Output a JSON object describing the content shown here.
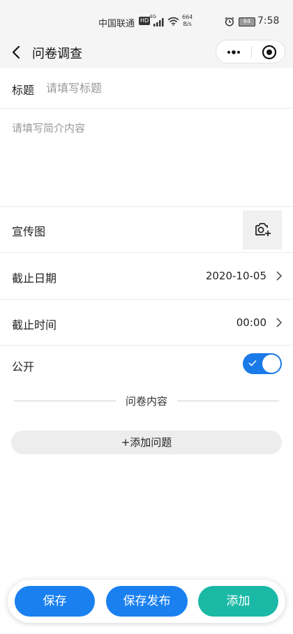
{
  "status_bar": {
    "carrier": "中国联通",
    "hd": "HD",
    "network": "4G",
    "speed_value": "664",
    "speed_unit": "B/s",
    "battery": "64",
    "time": "7:58"
  },
  "navbar": {
    "title": "问卷调查"
  },
  "form": {
    "title_label": "标题",
    "title_placeholder": "请填写标题",
    "intro_placeholder": "请填写简介内容",
    "banner_label": "宣传图",
    "deadline_date_label": "截止日期",
    "deadline_date_value": "2020-10-05",
    "deadline_time_label": "截止时间",
    "deadline_time_value": "00:00",
    "public_label": "公开",
    "public_on": true
  },
  "section": {
    "content_title": "问卷内容",
    "add_question_label": "+添加问题"
  },
  "actions": {
    "save_label": "保存",
    "save_publish_label": "保存发布",
    "add_label": "添加"
  },
  "colors": {
    "primary": "#1a80f0",
    "toggle": "#1a7ae8",
    "add": "#1ab9a6"
  }
}
